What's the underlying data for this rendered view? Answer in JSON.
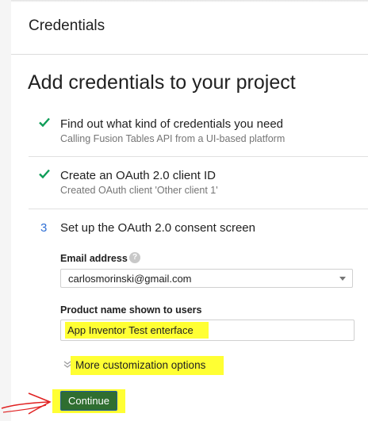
{
  "header": {
    "title": "Credentials"
  },
  "page": {
    "title": "Add credentials to your project"
  },
  "steps": [
    {
      "status": "done",
      "title": "Find out what kind of credentials you need",
      "subtitle": "Calling Fusion Tables API from a UI-based platform"
    },
    {
      "status": "done",
      "title": "Create an OAuth 2.0 client ID",
      "subtitle": "Created OAuth client 'Other client 1'"
    },
    {
      "status": "current",
      "number": "3",
      "title": "Set up the OAuth 2.0 consent screen"
    }
  ],
  "form": {
    "email_label": "Email address",
    "help_icon": "?",
    "email_value": "carlosmorinski@gmail.com",
    "product_label": "Product name shown to users",
    "product_value": "App Inventor Test enterface",
    "more_options": "More customization options",
    "continue_label": "Continue"
  },
  "colors": {
    "check": "#0f9d58",
    "step_number": "#2f6fd4",
    "highlight": "#ffff33",
    "continue_button": "#2f6e30",
    "annotation_arrow": "#e02020"
  },
  "icons": [
    "check-icon",
    "help-icon",
    "chevron-down-icon",
    "dropdown-arrow-icon",
    "red-arrow-annotation"
  ]
}
